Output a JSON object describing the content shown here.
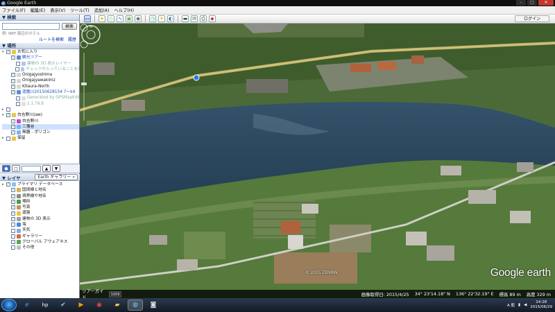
{
  "window": {
    "title": "Google Earth",
    "min": "–",
    "max": "□",
    "close": "✕"
  },
  "menu": [
    "ファイル(F)",
    "編集(E)",
    "表示(V)",
    "ツール(T)",
    "追加(A)",
    "ヘルプ(H)"
  ],
  "toolbar": {
    "login_label": "ログイン",
    "tools": [
      "sidebar-toggle-icon",
      "placemark-icon",
      "polygon-icon",
      "path-icon",
      "overlay-icon",
      "tour-icon",
      "historical-imagery-icon",
      "sunlight-icon",
      "planets-icon",
      "ruler-icon",
      "email-icon",
      "print-icon",
      "view-in-maps-icon"
    ]
  },
  "search": {
    "header": "▼ 検索",
    "button": "検索",
    "hint": "例: NRT 周辺のホテル",
    "route_link": "ルートを検索",
    "history_link": "履歴"
  },
  "places": {
    "header": "▼ 場所",
    "items": [
      {
        "label": "お気に入り",
        "level": 0,
        "checked": true,
        "expanded": true,
        "color": "black"
      },
      {
        "label": "観光ツアー",
        "level": 1,
        "checked": true,
        "color": "blue"
      },
      {
        "label": "建物の 3D 表示レイヤー",
        "level": 2,
        "checked": false,
        "color": "gray"
      },
      {
        "label": "チェックが入っていることを確認",
        "level": 2,
        "checked": false,
        "color": "gray"
      },
      {
        "label": "Onigajyoshima",
        "level": 1,
        "checked": true,
        "color": "black"
      },
      {
        "label": "Onigajyawakimz",
        "level": 1,
        "checked": true,
        "color": "black"
      },
      {
        "label": "Kitaura-North",
        "level": 1,
        "checked": true,
        "color": "black"
      },
      {
        "label": "道鑑川20150628154 7～k4",
        "level": 1,
        "checked": true,
        "color": "blue"
      },
      {
        "label": "Generated by GPSMapEdit",
        "level": 2,
        "checked": false,
        "color": "gray"
      },
      {
        "label": "2.1.78.8",
        "level": 2,
        "checked": false,
        "color": "gray"
      },
      {
        "label": "",
        "level": 0,
        "checked": false,
        "color": "black"
      },
      {
        "label": "白吉野川(aw)",
        "level": 0,
        "checked": true,
        "expanded": true,
        "color": "black"
      },
      {
        "label": "白吉野川",
        "level": 1,
        "checked": true,
        "color": "black"
      },
      {
        "label": "三藩谷",
        "level": 1,
        "checked": true,
        "color": "black",
        "highlight": true
      },
      {
        "label": "無題 - ポリゴン",
        "level": 1,
        "checked": true,
        "color": "black"
      },
      {
        "label": "保留",
        "level": 0,
        "checked": false,
        "color": "black"
      }
    ]
  },
  "navbar": {
    "up": "▲",
    "down": "▼"
  },
  "layers": {
    "header": "▼ レイヤ",
    "gallery_button": "Earth ギャラリー »",
    "items": [
      {
        "label": "プライマリ データベース",
        "level": 0,
        "checked": true
      },
      {
        "label": "国境線と地名",
        "level": 1,
        "checked": true
      },
      {
        "label": "境界線や地名",
        "level": 1,
        "checked": true
      },
      {
        "label": "場所",
        "level": 1,
        "checked": true
      },
      {
        "label": "写真",
        "level": 1,
        "checked": true
      },
      {
        "label": "道路",
        "level": 1,
        "checked": true
      },
      {
        "label": "建物の 3D 表示",
        "level": 1,
        "checked": true
      },
      {
        "label": "海",
        "level": 1,
        "checked": false
      },
      {
        "label": "天気",
        "level": 1,
        "checked": false
      },
      {
        "label": "ギャラリー",
        "level": 1,
        "checked": false
      },
      {
        "label": "グローバル アウェアネス",
        "level": 1,
        "checked": false
      },
      {
        "label": "その他",
        "level": 1,
        "checked": false
      }
    ]
  },
  "map": {
    "logo": "Google earth",
    "copyright": "© 2015 ZENRIN",
    "tour_label": "ツアーガイド",
    "tour_thumb": "1009",
    "status": {
      "imagery_date": "画像取得日: 2015/4/25",
      "lat": "34° 23'14.18\" N",
      "lon": "136° 22'32.19\" E",
      "elev": "標高  89 m",
      "alt": "高度  329 m"
    }
  },
  "taskbar": {
    "apps": [
      "internet-explorer-icon",
      "hp-icon",
      "checkmark-app-icon",
      "media-player-icon",
      "chrome-icon",
      "file-explorer-icon",
      "google-earth-icon",
      "camera-app-icon"
    ],
    "ime": "A 般",
    "time": "14:28",
    "date": "2015/06/29"
  }
}
